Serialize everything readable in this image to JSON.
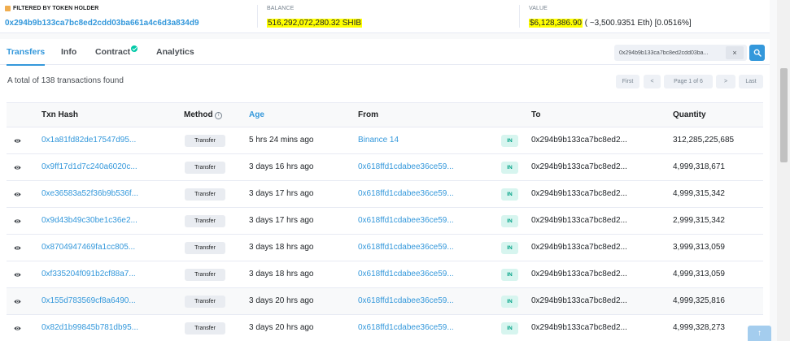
{
  "summary": {
    "holder_label": "FILTERED BY TOKEN HOLDER",
    "holder_address": "0x294b9b133ca7bc8ed2cdd03ba661a4c6d3a834d9",
    "balance_label": "BALANCE",
    "balance_value": "516,292,072,280.32 SHIB",
    "value_label": "VALUE",
    "value_usd": "$6,128,386.90",
    "value_rest": " ( ~3,500.9351 Eth) [0.0516%]"
  },
  "tabs": [
    {
      "label": "Transfers"
    },
    {
      "label": "Info"
    },
    {
      "label": "Contract"
    },
    {
      "label": "Analytics"
    }
  ],
  "filter": {
    "value": "0x294b9b133ca7bc8ed2cdd03ba...",
    "clear": "×"
  },
  "total_text": "A total of 138 transactions found",
  "pager": {
    "first": "First",
    "prev": "<",
    "page": "Page 1 of 6",
    "next": ">",
    "last": "Last"
  },
  "table": {
    "headers": {
      "txn_hash": "Txn Hash",
      "method": "Method",
      "age": "Age",
      "from": "From",
      "to": "To",
      "quantity": "Quantity"
    },
    "info_icon": "i",
    "rows": [
      {
        "hash": "0x1a81fd82de17547d95...",
        "method": "Transfer",
        "age": "5 hrs 24 mins ago",
        "from": "Binance 14",
        "dir": "IN",
        "to": "0x294b9b133ca7bc8ed2...",
        "qty": "312,285,225,685"
      },
      {
        "hash": "0x9ff17d1d7c240a6020c...",
        "method": "Transfer",
        "age": "3 days 16 hrs ago",
        "from": "0x618ffd1cdabee36ce59...",
        "dir": "IN",
        "to": "0x294b9b133ca7bc8ed2...",
        "qty": "4,999,318,671"
      },
      {
        "hash": "0xe36583a52f36b9b536f...",
        "method": "Transfer",
        "age": "3 days 17 hrs ago",
        "from": "0x618ffd1cdabee36ce59...",
        "dir": "IN",
        "to": "0x294b9b133ca7bc8ed2...",
        "qty": "4,999,315,342"
      },
      {
        "hash": "0x9d43b49c30be1c36e2...",
        "method": "Transfer",
        "age": "3 days 17 hrs ago",
        "from": "0x618ffd1cdabee36ce59...",
        "dir": "IN",
        "to": "0x294b9b133ca7bc8ed2...",
        "qty": "2,999,315,342"
      },
      {
        "hash": "0x8704947469fa1cc805...",
        "method": "Transfer",
        "age": "3 days 18 hrs ago",
        "from": "0x618ffd1cdabee36ce59...",
        "dir": "IN",
        "to": "0x294b9b133ca7bc8ed2...",
        "qty": "3,999,313,059"
      },
      {
        "hash": "0xf335204f091b2cf88a7...",
        "method": "Transfer",
        "age": "3 days 18 hrs ago",
        "from": "0x618ffd1cdabee36ce59...",
        "dir": "IN",
        "to": "0x294b9b133ca7bc8ed2...",
        "qty": "4,999,313,059"
      },
      {
        "hash": "0x155d783569cf8a6490...",
        "method": "Transfer",
        "age": "3 days 20 hrs ago",
        "from": "0x618ffd1cdabee36ce59...",
        "dir": "IN",
        "to": "0x294b9b133ca7bc8ed2...",
        "qty": "4,999,325,816"
      },
      {
        "hash": "0x82d1b99845b781db95...",
        "method": "Transfer",
        "age": "3 days 20 hrs ago",
        "from": "0x618ffd1cdabee36ce59...",
        "dir": "IN",
        "to": "0x294b9b133ca7bc8ed2...",
        "qty": "4,999,328,273"
      }
    ]
  },
  "scroll_top_label": "↑",
  "colors": {
    "accent": "#3498db",
    "highlight": "#ffff00",
    "in_badge": "#00a186",
    "verified": "#00c9a7"
  },
  "icons": [
    "orange-square-icon",
    "verified-check-icon",
    "search-icon",
    "eye-icon",
    "info-icon",
    "arrow-up-icon"
  ]
}
